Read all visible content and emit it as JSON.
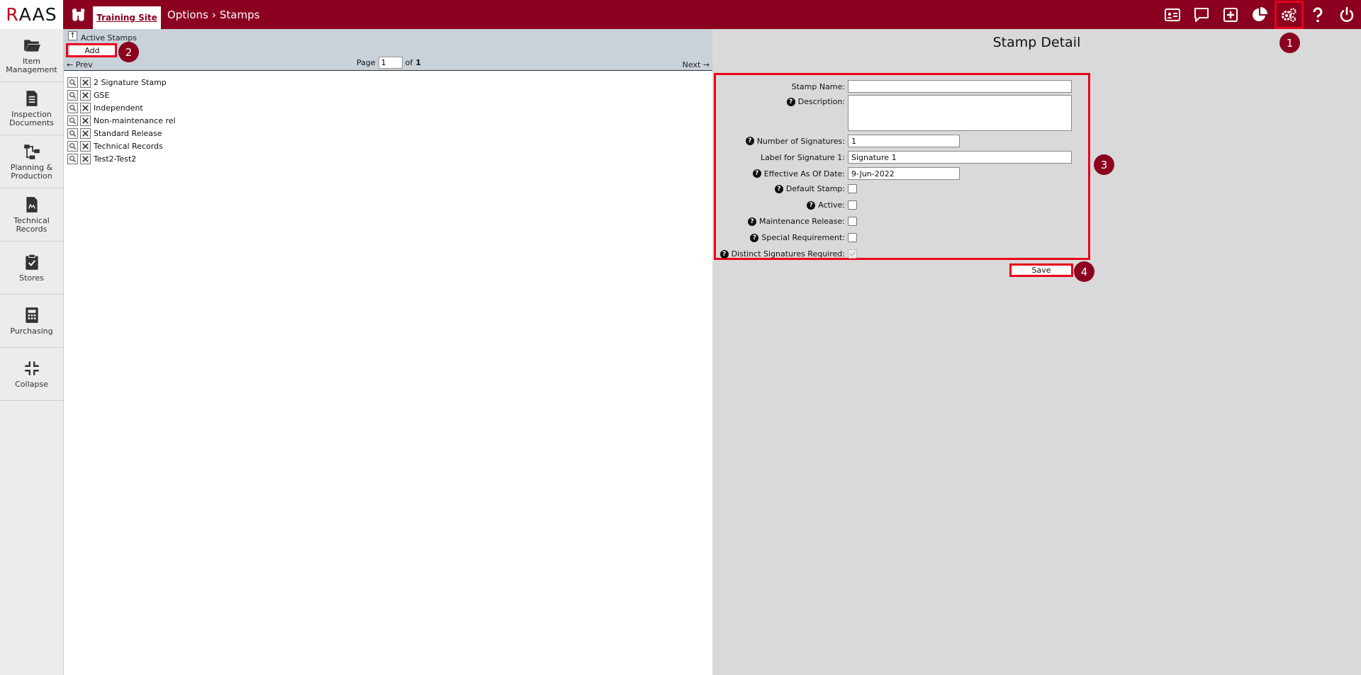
{
  "header": {
    "logo": "RAAS",
    "logo_first": "R",
    "logo_rest": "AAS",
    "site_tab": "Training Site",
    "breadcrumb": [
      "Options",
      "Stamps"
    ],
    "breadcrumb_separator": "›"
  },
  "top_icons": [
    "id-card-icon",
    "chat-icon",
    "plus-box-icon",
    "pie-chart-icon",
    "gears-icon",
    "help-icon",
    "power-icon"
  ],
  "sidebar": {
    "items": [
      {
        "label1": "Item",
        "label2": "Management",
        "icon": "folder-icon"
      },
      {
        "label1": "Inspection",
        "label2": "Documents",
        "icon": "document-icon"
      },
      {
        "label1": "Planning &",
        "label2": "Production",
        "icon": "flow-icon"
      },
      {
        "label1": "Technical",
        "label2": "Records",
        "icon": "records-icon"
      },
      {
        "label1": "Stores",
        "label2": "",
        "icon": "clipboard-check-icon"
      },
      {
        "label1": "Purchasing",
        "label2": "",
        "icon": "calculator-icon"
      },
      {
        "label1": "Collapse",
        "label2": "",
        "icon": "collapse-icon"
      }
    ]
  },
  "list": {
    "title": "Active Stamps",
    "add_label": "Add",
    "prev_label": "← Prev",
    "next_label": "Next →",
    "page_label": "Page",
    "page_value": "1",
    "of_label": "of",
    "total_pages": "1",
    "items": [
      "2 Signature Stamp",
      "GSE",
      "Independent",
      "Non-maintenance rel",
      "Standard Release",
      "Technical Records",
      "Test2-Test2"
    ]
  },
  "detail": {
    "title": "Stamp Detail",
    "fields": {
      "stamp_name_label": "Stamp Name:",
      "stamp_name_value": "",
      "description_label": "Description:",
      "description_value": "",
      "num_signatures_label": "Number of Signatures:",
      "num_signatures_value": "1",
      "sig1_label": "Label for Signature 1:",
      "sig1_value": "Signature 1",
      "effective_label": "Effective As Of Date:",
      "effective_value": "9-Jun-2022",
      "default_label": "Default Stamp:",
      "default_checked": false,
      "active_label": "Active:",
      "active_checked": false,
      "maint_label": "Maintenance Release:",
      "maint_checked": false,
      "special_label": "Special Requirement:",
      "special_checked": false,
      "distinct_label": "Distinct Signatures Required:",
      "distinct_checked": true
    },
    "help_glyph": "?",
    "save_label": "Save"
  },
  "annotations": {
    "markers": [
      "1",
      "2",
      "3",
      "4"
    ],
    "color": "#e8001c",
    "marker_color": "#8b001e"
  },
  "colors": {
    "brand": "#8b001e",
    "header_band": "#c9d1d9",
    "detail_bg": "#d9d9d9"
  }
}
